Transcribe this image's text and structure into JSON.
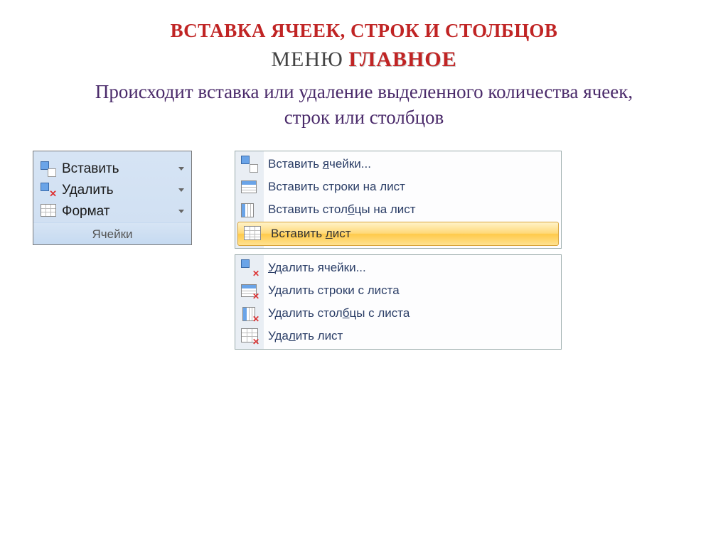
{
  "heading": {
    "title": "ВСТАВКА   ЯЧЕЕК,  СТРОК  И  СТОЛБЦОВ",
    "menu_word": "МЕНЮ",
    "main_word": "ГЛАВНОЕ",
    "description": "Происходит вставка или удаление выделенного количества ячеек,  строк  или  столбцов"
  },
  "ribbon": {
    "insert": "Вставить",
    "delete": "Удалить",
    "format": "Формат",
    "group_label": "Ячейки"
  },
  "insert_menu": {
    "cells": "Вставить ячейки...",
    "rows": "Вставить строки на лист",
    "cols": "Вставить столбцы на лист",
    "sheet": "Вставить лист"
  },
  "delete_menu": {
    "cells": "Удалить ячейки...",
    "rows": "Удалить строки с листа",
    "cols": "Удалить столбцы с листа",
    "sheet": "Удалить лист"
  }
}
